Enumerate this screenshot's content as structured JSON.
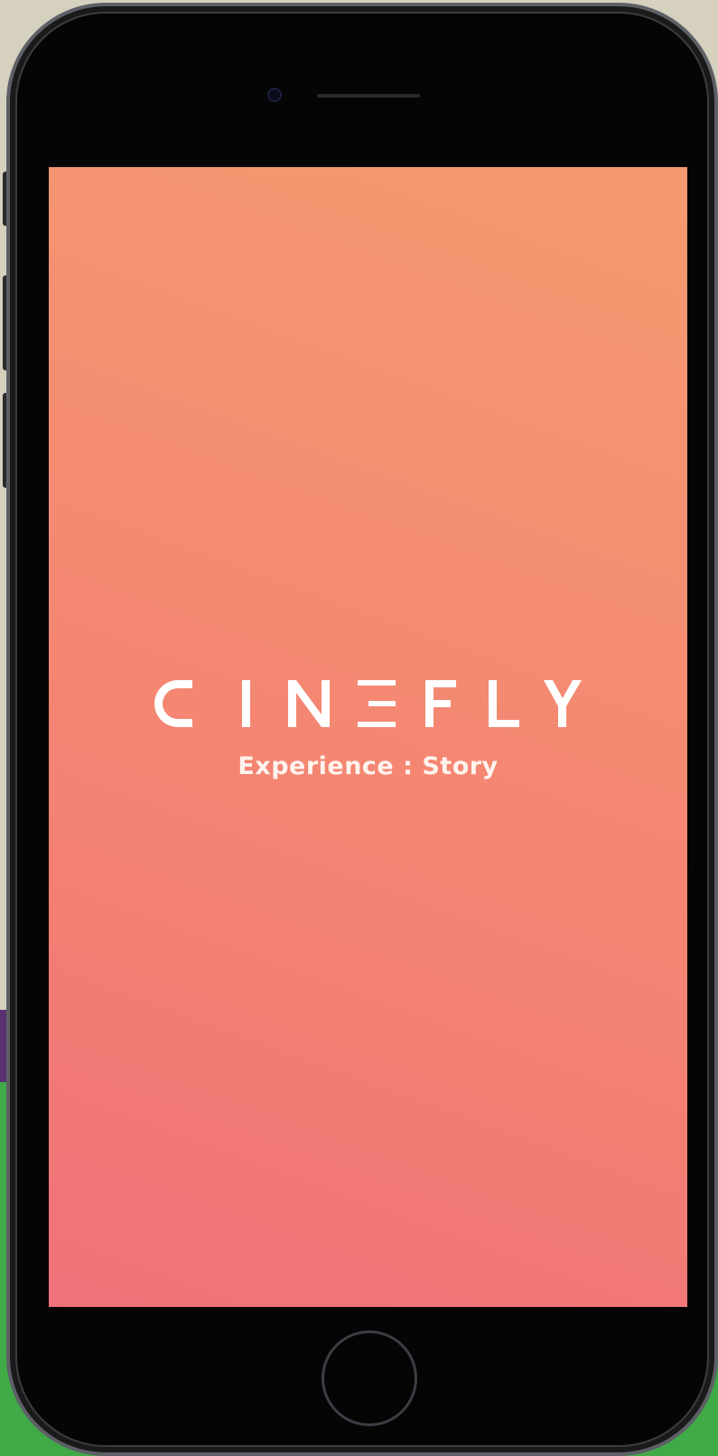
{
  "app": {
    "logo_text": "CINEFLY",
    "tagline": "Experience : Story"
  },
  "colors": {
    "screen_gradient": [
      "#f59a70",
      "#f48d72",
      "#f37f73",
      "#f0717a"
    ],
    "logo_text_color": "#ffffff",
    "phone_body": "#050505"
  },
  "icons": [
    "front-camera-icon",
    "speaker-grille-icon",
    "home-button-icon"
  ]
}
